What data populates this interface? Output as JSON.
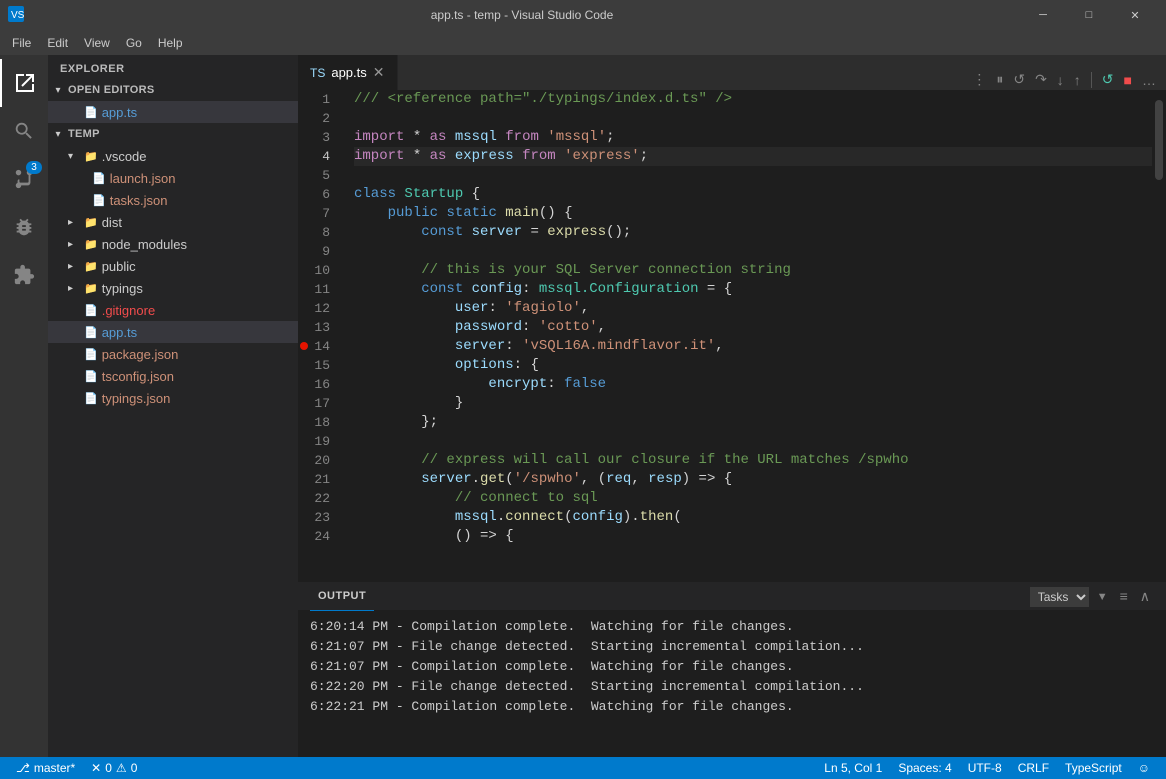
{
  "titlebar": {
    "title": "app.ts - temp - Visual Studio Code",
    "app_icon": "●",
    "minimize": "─",
    "maximize": "□",
    "close": "✕"
  },
  "menubar": {
    "items": [
      "File",
      "Edit",
      "View",
      "Go",
      "Help"
    ]
  },
  "activitybar": {
    "icons": [
      {
        "name": "explorer-icon",
        "symbol": "⎘",
        "active": true
      },
      {
        "name": "search-icon",
        "symbol": "🔍",
        "active": false
      },
      {
        "name": "source-control-icon",
        "symbol": "⑂",
        "active": false,
        "badge": "3"
      },
      {
        "name": "debug-icon",
        "symbol": "🐛",
        "active": false
      },
      {
        "name": "extensions-icon",
        "symbol": "⊞",
        "active": false
      }
    ]
  },
  "sidebar": {
    "section_title": "EXPLORER",
    "open_editors_title": "OPEN EDITORS",
    "open_editors": [
      "app.ts"
    ],
    "project_name": "TEMP",
    "tree": [
      {
        "name": ".vscode",
        "type": "folder",
        "level": 1,
        "expanded": true
      },
      {
        "name": "launch.json",
        "type": "file-json",
        "level": 2
      },
      {
        "name": "tasks.json",
        "type": "file-json",
        "level": 2
      },
      {
        "name": "dist",
        "type": "folder",
        "level": 1,
        "expanded": false
      },
      {
        "name": "node_modules",
        "type": "folder",
        "level": 1,
        "expanded": false
      },
      {
        "name": "public",
        "type": "folder",
        "level": 1,
        "expanded": false
      },
      {
        "name": "typings",
        "type": "folder",
        "level": 1,
        "expanded": false
      },
      {
        "name": ".gitignore",
        "type": "file-git",
        "level": 1
      },
      {
        "name": "app.ts",
        "type": "file-ts",
        "level": 1,
        "active": true
      },
      {
        "name": "package.json",
        "type": "file-json",
        "level": 1
      },
      {
        "name": "tsconfig.json",
        "type": "file-json",
        "level": 1
      },
      {
        "name": "typings.json",
        "type": "file-json",
        "level": 1
      }
    ]
  },
  "editor": {
    "tab_name": "app.ts",
    "toolbar_buttons": [
      "split",
      "pause",
      "restart",
      "step-over",
      "step-into",
      "step-out",
      "stop"
    ]
  },
  "code": {
    "lines": [
      {
        "num": 1,
        "content": "/// <reference path=\"./typings/index.d.ts\" />"
      },
      {
        "num": 2,
        "content": ""
      },
      {
        "num": 3,
        "content": "import * as mssql from 'mssql';"
      },
      {
        "num": 4,
        "content": "import * as express from 'express';",
        "highlight": true
      },
      {
        "num": 5,
        "content": ""
      },
      {
        "num": 6,
        "content": "class Startup {"
      },
      {
        "num": 7,
        "content": "    public static main() {"
      },
      {
        "num": 8,
        "content": "        const server = express();"
      },
      {
        "num": 9,
        "content": ""
      },
      {
        "num": 10,
        "content": "        // this is your SQL Server connection string"
      },
      {
        "num": 11,
        "content": "        const config: mssql.Configuration = {"
      },
      {
        "num": 12,
        "content": "            user: 'fagiolo',"
      },
      {
        "num": 13,
        "content": "            password: 'cotto',"
      },
      {
        "num": 14,
        "content": "            server: 'vSQL16A.mindflavor.it',",
        "breakpoint": true
      },
      {
        "num": 15,
        "content": "            options: {"
      },
      {
        "num": 16,
        "content": "                encrypt: false"
      },
      {
        "num": 17,
        "content": "            }"
      },
      {
        "num": 18,
        "content": "        };"
      },
      {
        "num": 19,
        "content": ""
      },
      {
        "num": 20,
        "content": "        // express will call our closure if the URL matches /spwho"
      },
      {
        "num": 21,
        "content": "        server.get('/spwho', (req, resp) => {"
      },
      {
        "num": 22,
        "content": "            // connect to sql"
      },
      {
        "num": 23,
        "content": "            mssql.connect(config).then("
      },
      {
        "num": 24,
        "content": "            () => {"
      }
    ]
  },
  "output": {
    "panel_title": "OUTPUT",
    "tasks_label": "Tasks",
    "lines": [
      "6:20:14 PM - Compilation complete.  Watching for file changes.",
      "6:21:07 PM - File change detected.  Starting incremental compilation...",
      "6:21:07 PM - Compilation complete.  Watching for file changes.",
      "6:22:20 PM - File change detected.  Starting incremental compilation...",
      "6:22:21 PM - Compilation complete.  Watching for file changes."
    ]
  },
  "statusbar": {
    "branch": "master*",
    "errors": "0",
    "warnings": "0",
    "ln": "Ln 5, Col 1",
    "spaces": "Spaces: 4",
    "encoding": "UTF-8",
    "line_ending": "CRLF",
    "language": "TypeScript",
    "smiley": "☺"
  }
}
